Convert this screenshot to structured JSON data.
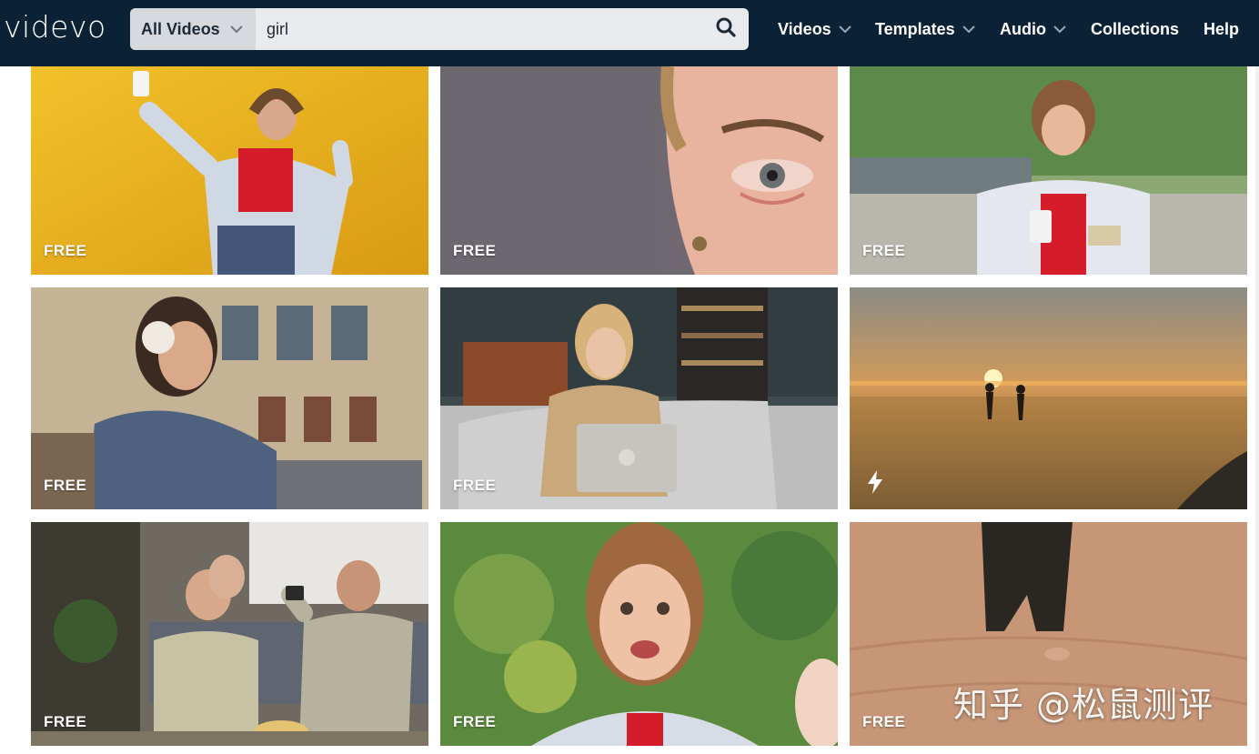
{
  "brand": {
    "logo_text": "videvo"
  },
  "search": {
    "category_label": "All Videos",
    "query": "girl",
    "placeholder": ""
  },
  "nav": {
    "items": [
      {
        "label": "Videos",
        "has_dropdown": true
      },
      {
        "label": "Templates",
        "has_dropdown": true
      },
      {
        "label": "Audio",
        "has_dropdown": true
      },
      {
        "label": "Collections",
        "has_dropdown": false
      },
      {
        "label": "Help",
        "has_dropdown": false
      }
    ]
  },
  "results": [
    {
      "subject": "woman dancing with headphones and phone against yellow wall",
      "badge": "FREE"
    },
    {
      "subject": "close-up of tearful eye",
      "badge": "FREE"
    },
    {
      "subject": "woman paying with phone and card in park",
      "badge": "FREE"
    },
    {
      "subject": "woman with headphones using phone in city",
      "badge": "FREE"
    },
    {
      "subject": "woman with laptop on sofa",
      "badge": "FREE"
    },
    {
      "subject": "couple walking on beach at sunset",
      "badge": "",
      "premium_icon": "lightning-bolt-icon"
    },
    {
      "subject": "friends watching TV on sofa with remote",
      "badge": "FREE"
    },
    {
      "subject": "woman talking to camera outdoors",
      "badge": "FREE"
    },
    {
      "subject": "barefoot walk in desert sand",
      "badge": "FREE"
    }
  ],
  "watermark": {
    "text": "知乎 @松鼠测评"
  },
  "colors": {
    "topbar": "#0b2236",
    "search_bg": "#e9ebee",
    "category_bg": "#d6dade",
    "badge_text": "#ffffff"
  }
}
